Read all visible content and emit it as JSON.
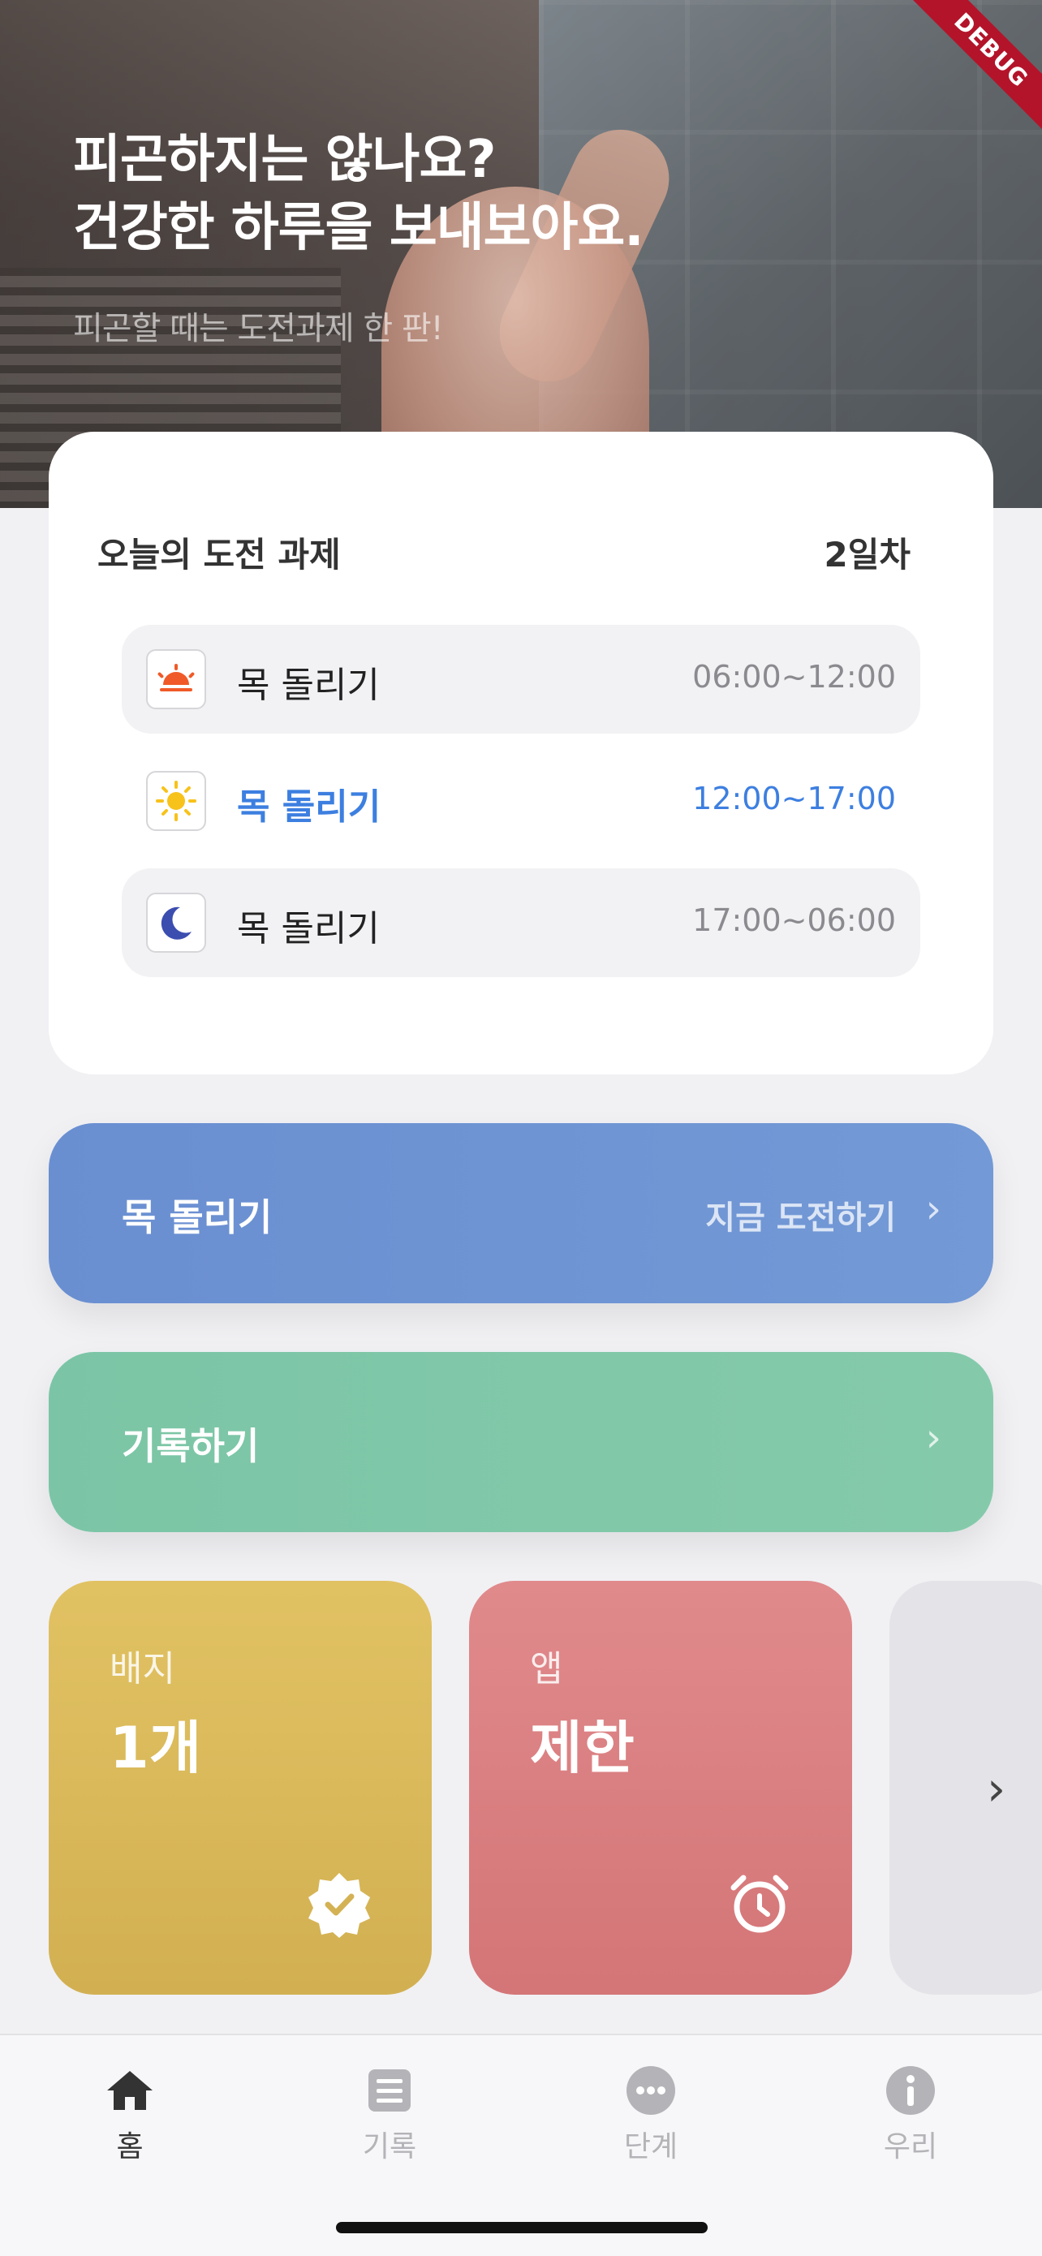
{
  "hero": {
    "title": "피곤하지는 않나요?\n건강한 하루을 보내보아요.",
    "subtitle": "피곤할 때는 도전과제 한 판!",
    "debug_banner": "DEBUG"
  },
  "challenge_card": {
    "title": "오늘의 도전 과제",
    "day": "2일차",
    "items": [
      {
        "icon": "sunrise-icon",
        "name": "목 돌리기",
        "time": "06:00~12:00",
        "active": false
      },
      {
        "icon": "sun-icon",
        "name": "목 돌리기",
        "time": "12:00~17:00",
        "active": true
      },
      {
        "icon": "moon-icon",
        "name": "목 돌리기",
        "time": "17:00~06:00",
        "active": false
      }
    ]
  },
  "actions": {
    "challenge": {
      "label": "목 돌리기",
      "cta": "지금 도전하기"
    },
    "record": {
      "label": "기록하기"
    }
  },
  "tiles": [
    {
      "caption": "배지",
      "value": "1개",
      "icon": "badge-check-icon",
      "color": "#d9b95b"
    },
    {
      "caption": "앱",
      "value": "제한",
      "icon": "alarm-clock-icon",
      "color": "#da8082"
    }
  ],
  "tabbar": {
    "tabs": [
      {
        "label": "홈",
        "icon": "home-icon",
        "active": true
      },
      {
        "label": "기록",
        "icon": "list-icon",
        "active": false
      },
      {
        "label": "단계",
        "icon": "more-dots-icon",
        "active": false
      },
      {
        "label": "우리",
        "icon": "info-icon",
        "active": false
      }
    ]
  },
  "colors": {
    "accent_blue": "#3d7fe0",
    "challenge_button": "#6f94d3",
    "record_button": "#80c8a8",
    "sunrise": "#f05a28",
    "sun": "#f7c21a",
    "moon": "#3c4db0"
  }
}
